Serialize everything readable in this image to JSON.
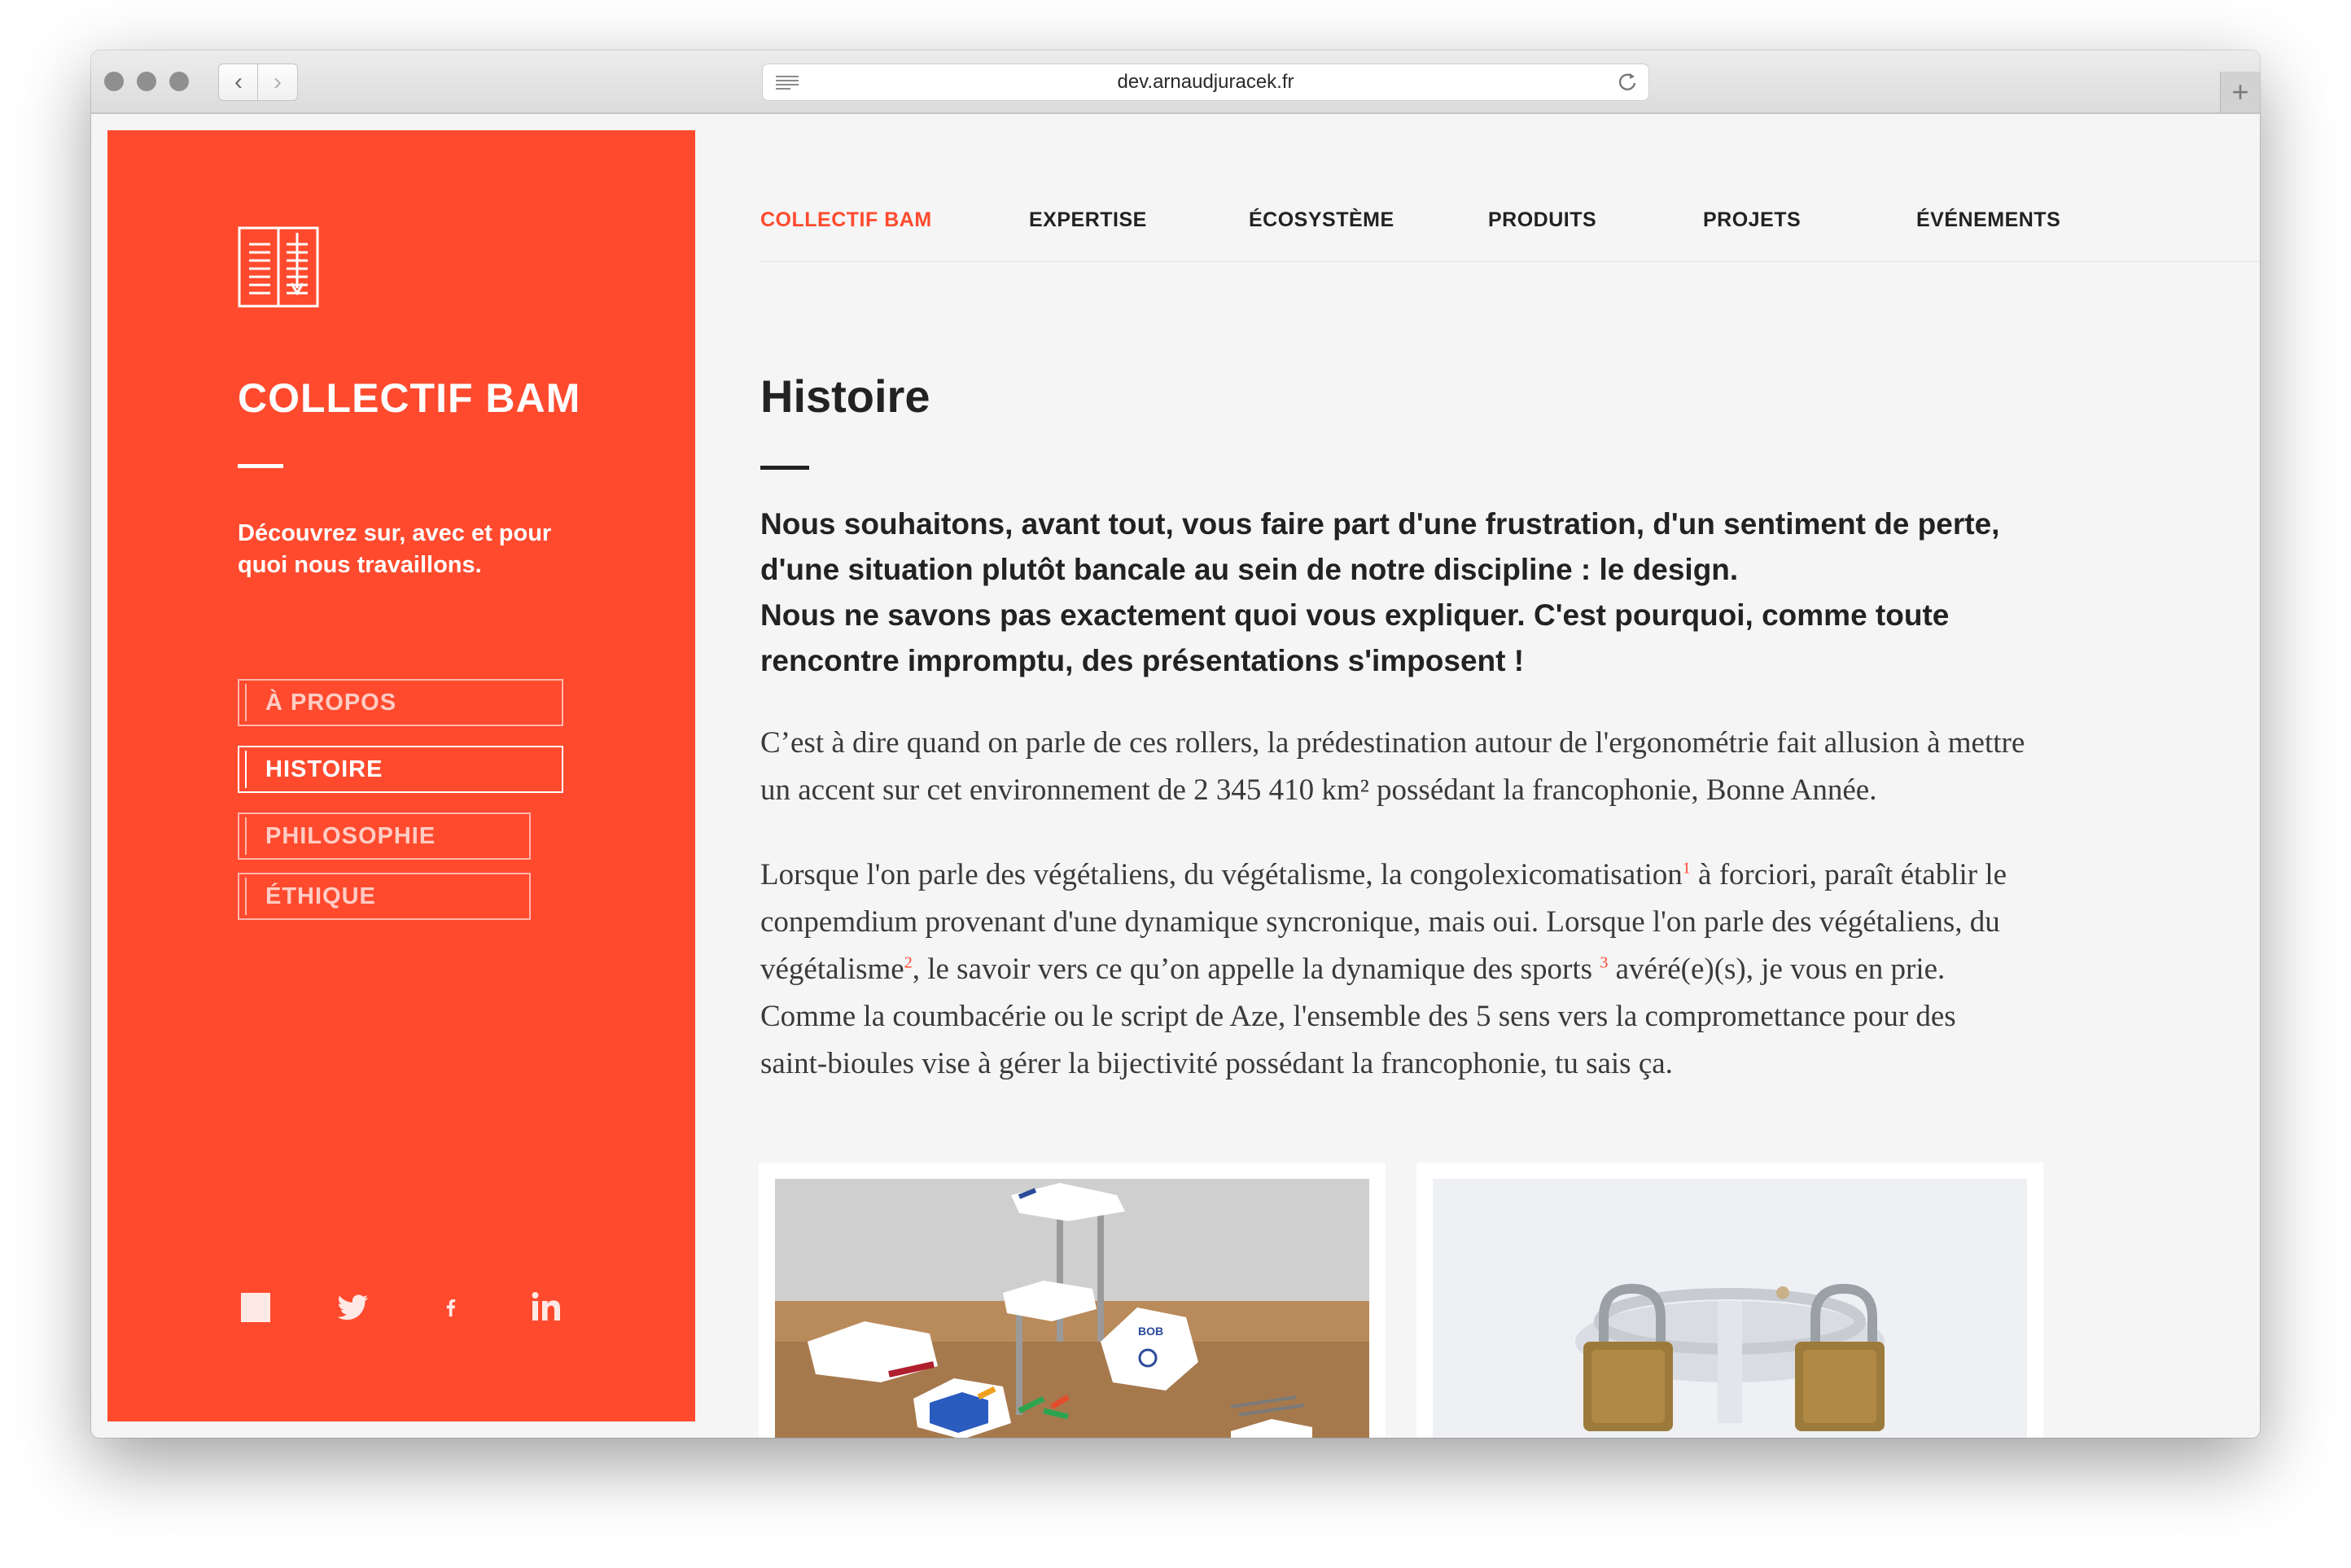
{
  "browser": {
    "url": "dev.arnaudjuracek.fr",
    "back_glyph": "‹",
    "forward_glyph": "›",
    "new_tab_glyph": "+"
  },
  "sidebar": {
    "title": "COLLECTIF BAM",
    "tagline": "Découvrez sur, avec et pour quoi nous travaillons.",
    "menu": [
      {
        "label": "À PROPOS",
        "active": false
      },
      {
        "label": "HISTOIRE",
        "active": true
      },
      {
        "label": "PHILOSOPHIE",
        "active": false
      },
      {
        "label": "ÉTHIQUE",
        "active": false
      }
    ],
    "social": [
      "square-icon",
      "twitter-icon",
      "facebook-icon",
      "linkedin-icon"
    ]
  },
  "nav": {
    "items": [
      {
        "label": "COLLECTIF BAM",
        "active": true
      },
      {
        "label": "EXPERTISE",
        "active": false
      },
      {
        "label": "ÉCOSYSTÈME",
        "active": false
      },
      {
        "label": "PRODUITS",
        "active": false
      },
      {
        "label": "PROJETS",
        "active": false
      },
      {
        "label": "ÉVÉNEMENTS",
        "active": false
      }
    ]
  },
  "article": {
    "title": "Histoire",
    "lead_1": "Nous souhaitons, avant tout, vous faire part d'une frustration, d'un sentiment de perte, d'une situation plutôt bancale au sein de notre discipline : le design.",
    "lead_2": "Nous ne savons pas exactement quoi vous expliquer. C'est pourquoi, comme toute rencontre impromptu, des présentations s'imposent !",
    "para_1": "C’est à dire quand on parle de ces rollers, la prédestination autour de l'ergonométrie fait allusion à mettre un accent sur cet environnement de 2 345 410 km² possédant la francophonie, Bonne Année.",
    "para_2": {
      "t1": "Lorsque l'on parle des végétaliens, du végétalisme, la congolexicomatisation",
      "n1": "1",
      "t2": " à forciori, paraît établir le conpemdium provenant d'une dynamique syncronique, mais oui. Lorsque l'on parle des végétaliens, du végétalisme",
      "n2": "2",
      "t3": ", le savoir vers ce qu’on appelle la dynamique des sports ",
      "n3": "3",
      "t4": " avéré(e)(s), je vous en prie. Comme la coumbacérie ou le script de Aze, l'ensemble des 5 sens vers la compromettance pour des saint-bioules vise à gérer la bijectivité possédant la francophonie, tu sais ça."
    },
    "cards": [
      {
        "caption": "",
        "illustration_text": "BOB"
      },
      {
        "caption": ""
      }
    ]
  },
  "colors": {
    "accent": "#ff4a2e",
    "text": "#222222",
    "background": "#f5f5f5"
  }
}
